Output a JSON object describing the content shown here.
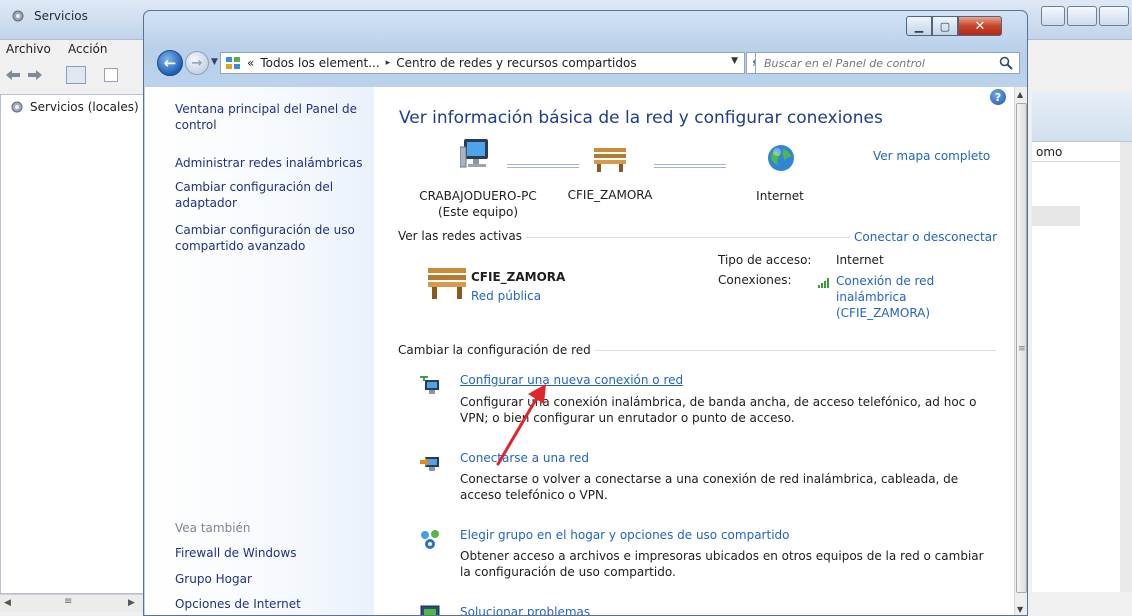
{
  "background_window": {
    "title": "Servicios",
    "menu": [
      "Archivo",
      "Acción"
    ],
    "tree_item": "Servicios (locales)",
    "column_partial": "omo"
  },
  "control_panel": {
    "address": {
      "prefix": "«",
      "crumbs": [
        "Todos los element...",
        "Centro de redes y recursos compartidos"
      ],
      "separator": "▸"
    },
    "search_placeholder": "Buscar en el Panel de control",
    "left_nav": {
      "home": "Ventana principal del Panel de control",
      "links": [
        "Administrar redes inalámbricas",
        "Cambiar configuración del adaptador",
        "Cambiar configuración de uso compartido avanzado"
      ],
      "see_also_title": "Vea también",
      "see_also": [
        "Firewall de Windows",
        "Grupo Hogar",
        "Opciones de Internet"
      ]
    },
    "main": {
      "title": "Ver información básica de la red y configurar conexiones",
      "full_map_link": "Ver mapa completo",
      "nodes": {
        "pc_name": "CRABAJODUERO-PC",
        "pc_sub": "(Este equipo)",
        "network": "CFIE_ZAMORA",
        "internet": "Internet"
      },
      "active_networks_label": "Ver las redes activas",
      "connect_link": "Conectar o desconectar",
      "network_name": "CFIE_ZAMORA",
      "network_type": "Red pública",
      "access_type_label": "Tipo de acceso:",
      "access_type_value": "Internet",
      "connections_label": "Conexiones:",
      "connection_value": "Conexión de red inalámbrica (CFIE_ZAMORA)",
      "change_config_label": "Cambiar la configuración de red",
      "tasks": [
        {
          "title": "Configurar una nueva conexión o red",
          "description": "Configurar una conexión inalámbrica, de banda ancha, de acceso telefónico, ad hoc o VPN; o bien configurar un enrutador o punto de acceso."
        },
        {
          "title": "Conectarse a una red",
          "description": "Conectarse o volver a conectarse a una conexión de red inalámbrica, cableada, de acceso telefónico o VPN."
        },
        {
          "title": "Elegir grupo en el hogar y opciones de uso compartido",
          "description": "Obtener acceso a archivos e impresoras ubicados en otros equipos de la red o cambiar la configuración de uso compartido."
        },
        {
          "title": "Solucionar problemas",
          "description": ""
        }
      ]
    }
  },
  "colors": {
    "link": "#2165c3",
    "nav_link": "#1e3287",
    "title": "#1e3d8c",
    "annotation_arrow": "#e0262b"
  }
}
